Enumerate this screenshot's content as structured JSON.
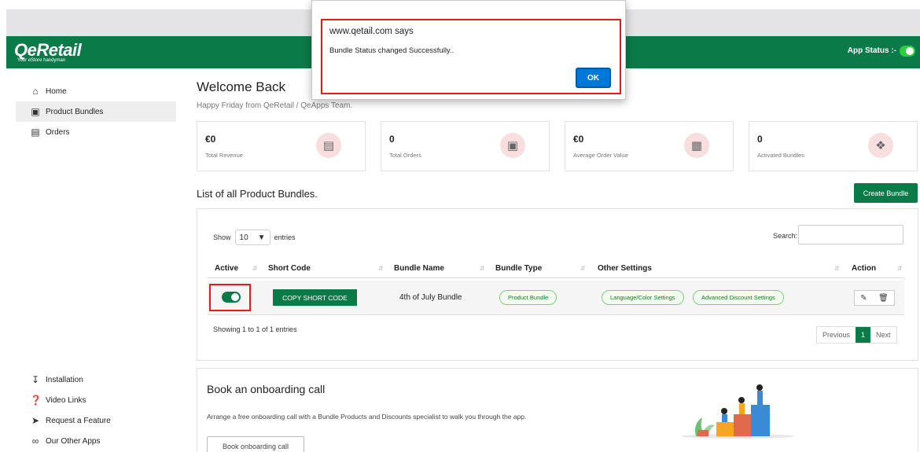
{
  "header": {
    "logo": "QeRetail",
    "logo_tag": "Your eStore handyman",
    "app_status_label": "App Status :-"
  },
  "sidebar": {
    "items": [
      {
        "label": "Home",
        "icon": "home-icon"
      },
      {
        "label": "Product Bundles",
        "icon": "gift-icon"
      },
      {
        "label": "Orders",
        "icon": "cart-icon"
      }
    ],
    "bottom_items": [
      {
        "label": "Installation",
        "icon": "download-icon"
      },
      {
        "label": "Video Links",
        "icon": "question-icon"
      },
      {
        "label": "Request a Feature",
        "icon": "arrow-circle-icon"
      },
      {
        "label": "Our Other Apps",
        "icon": "link-icon"
      }
    ]
  },
  "welcome": {
    "title": "Welcome Back",
    "subtitle": "Happy Friday from QeRetail / QeApps Team."
  },
  "stats": [
    {
      "value": "€0",
      "label": "Total Revenue"
    },
    {
      "value": "0",
      "label": "Total Orders"
    },
    {
      "value": "€0",
      "label": "Average Order Value"
    },
    {
      "value": "0",
      "label": "Activated Bundles"
    }
  ],
  "list": {
    "title": "List of all Product Bundles.",
    "create_button": "Create Bundle",
    "show_label": "Show",
    "entries_value": "10",
    "entries_label": "entries",
    "search_label": "Search:",
    "columns": [
      "Active",
      "Short Code",
      "Bundle Name",
      "Bundle Type",
      "Other Settings",
      "Action"
    ],
    "row": {
      "copy_button": "COPY SHORT CODE",
      "bundle_name": "4th of July Bundle",
      "bundle_type": "Product Bundle",
      "setting_1": "Language/Color Settings",
      "setting_2": "Advanced Discount Settings"
    },
    "showing": "Showing 1 to 1 of 1 entries",
    "prev": "Previous",
    "page": "1",
    "next": "Next"
  },
  "onboarding": {
    "title": "Book an onboarding call",
    "description": "Arrange a free onboarding call with a Bundle Products and Discounts specialist to walk you through the app.",
    "button": "Book onboarding call"
  },
  "dialog": {
    "title": "www.qetail.com says",
    "message": "Bundle Status changed Successfully..",
    "ok": "OK"
  },
  "colors": {
    "brand": "#0b7a49",
    "highlight": "#e31b1b",
    "ok_button": "#0078d7"
  }
}
